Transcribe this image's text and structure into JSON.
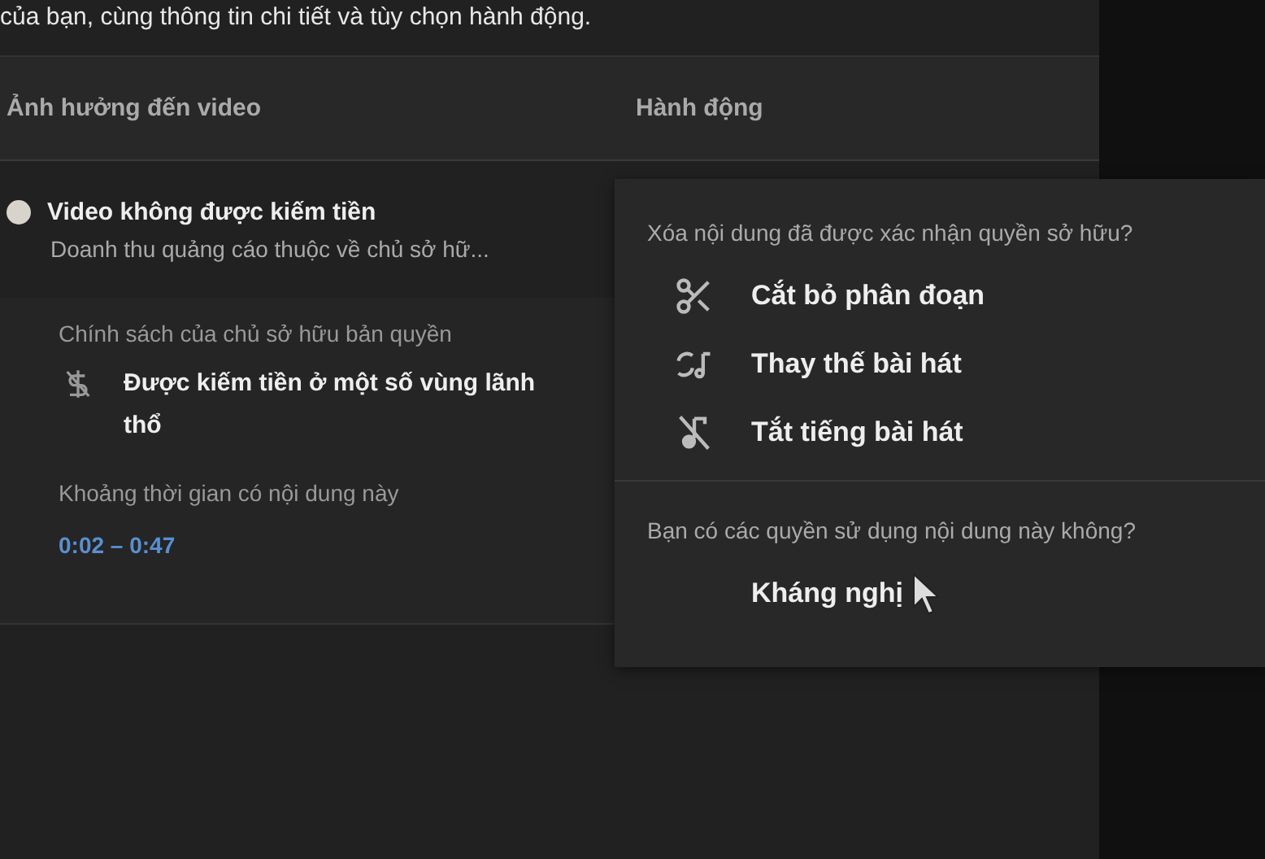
{
  "intro": {
    "text": "của bạn, cùng thông tin chi tiết và tùy chọn hành động."
  },
  "table": {
    "columns": [
      "Ảnh hưởng đến video",
      "Hành động"
    ]
  },
  "claim": {
    "title": "Video không được kiếm tiền",
    "subtitle": "Doanh thu quảng cáo thuộc về chủ sở hữ...",
    "policy_label": "Chính sách của chủ sở hữu bản quyền",
    "policy": "Được kiếm tiền ở một số vùng lãnh thổ",
    "range_label": "Khoảng thời gian có nội dung này",
    "range": "0:02 – 0:47"
  },
  "menu": {
    "sections": [
      {
        "heading": "Xóa nội dung đã được xác nhận quyền sở hữu?",
        "items": [
          {
            "kind": "scissors",
            "label": "Cắt bỏ phân đoạn"
          },
          {
            "kind": "replace",
            "label": "Thay thế bài hát"
          },
          {
            "kind": "mute",
            "label": "Tắt tiếng bài hát"
          }
        ]
      },
      {
        "heading": "Bạn có các quyền sử dụng nội dung này không?",
        "items": [
          {
            "kind": "none",
            "label": "Kháng nghị"
          }
        ]
      }
    ]
  }
}
